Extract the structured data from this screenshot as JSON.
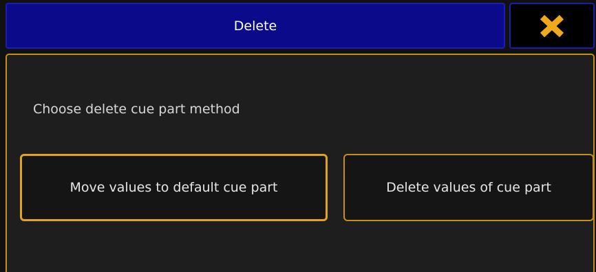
{
  "dialog": {
    "title": "Delete",
    "close_icon": "close-icon",
    "prompt": "Choose delete cue part method",
    "options": [
      {
        "label": "Move values to default cue part",
        "selected": true
      },
      {
        "label": "Delete values of cue part",
        "selected": false
      }
    ]
  },
  "colors": {
    "title_bar": "#0a0a8a",
    "accent": "#e6a317",
    "panel": "#1e1e1e",
    "close_icon": "#f0a81c"
  }
}
